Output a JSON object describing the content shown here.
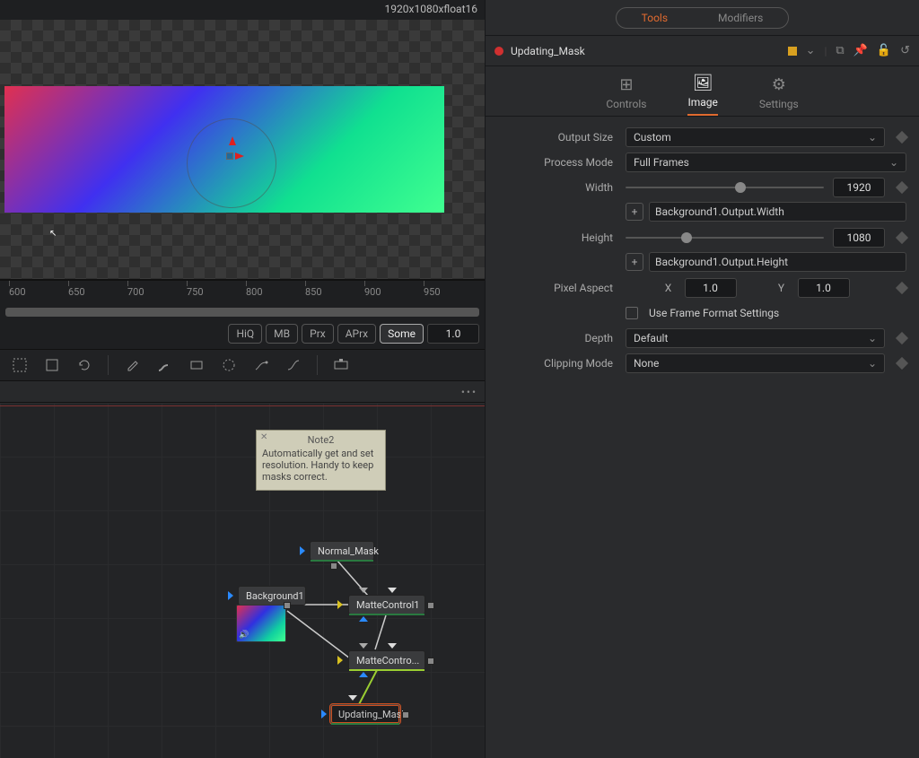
{
  "viewer": {
    "info": "1920x1080xfloat16"
  },
  "ruler": {
    "ticks": [
      "600",
      "650",
      "700",
      "750",
      "800",
      "850",
      "900",
      "950"
    ]
  },
  "quality": {
    "hiq": "HiQ",
    "mb": "MB",
    "prx": "Prx",
    "aprx": "APrx",
    "some": "Some",
    "scale": "1.0"
  },
  "options_menu": "•••",
  "note": {
    "title": "Note2",
    "body": "Automatically get and set resolution. Handy to keep masks correct."
  },
  "nodes": {
    "normal_mask": "Normal_Mask",
    "background": "Background1",
    "matte1": "MatteControl1",
    "matte2": "MatteContro...",
    "updating": "Updating_Mask"
  },
  "inspector": {
    "tabs": {
      "tools": "Tools",
      "modifiers": "Modifiers"
    },
    "node_name": "Updating_Mask",
    "subtabs": {
      "controls": "Controls",
      "image": "Image",
      "settings": "Settings"
    },
    "labels": {
      "output_size": "Output Size",
      "process_mode": "Process Mode",
      "width": "Width",
      "height": "Height",
      "pixel_aspect": "Pixel Aspect",
      "use_frame_format": "Use Frame Format Settings",
      "depth": "Depth",
      "clipping": "Clipping Mode",
      "x": "X",
      "y": "Y"
    },
    "values": {
      "output_size": "Custom",
      "process_mode": "Full Frames",
      "width": "1920",
      "width_expr": "Background1.Output.Width",
      "height": "1080",
      "height_expr": "Background1.Output.Height",
      "aspect_x": "1.0",
      "aspect_y": "1.0",
      "depth": "Default",
      "clipping": "None"
    }
  }
}
